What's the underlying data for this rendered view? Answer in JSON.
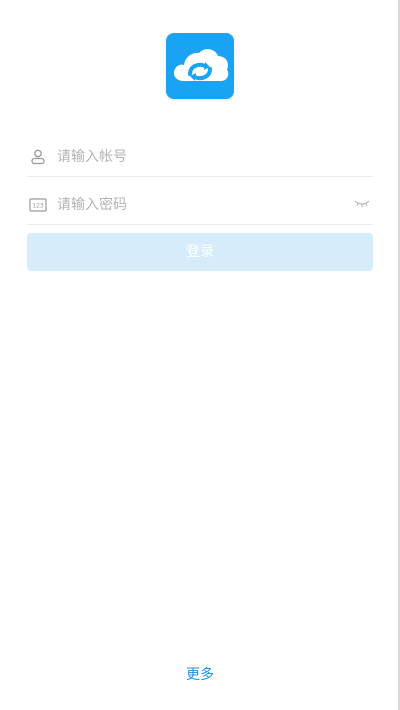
{
  "app": {
    "logo_icon": "cloud-sync-icon",
    "brand_color": "#1aa3f2"
  },
  "login_form": {
    "account_placeholder": "请输入帐号",
    "account_icon": "user-icon",
    "password_placeholder": "请输入密码",
    "password_icon": "keypad-123-icon",
    "password_visibility_icon": "eye-closed-icon",
    "login_label": "登录",
    "login_button_color": "#d6ecfb"
  },
  "footer": {
    "more_label": "更多",
    "link_color": "#1a8fe3"
  }
}
